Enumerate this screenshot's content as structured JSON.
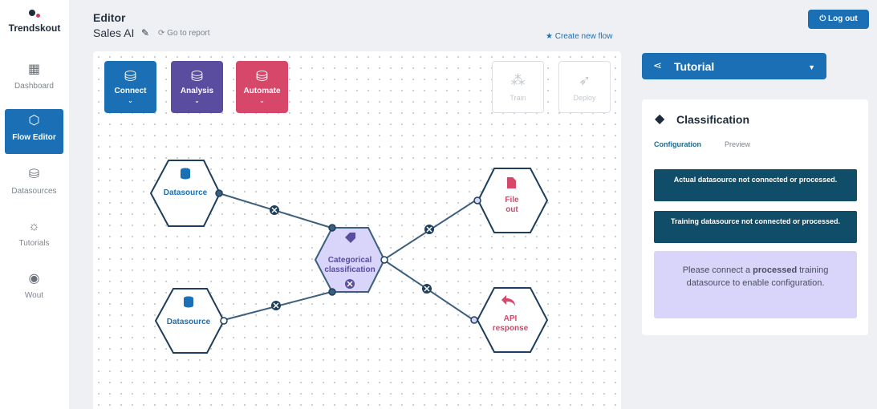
{
  "brand": {
    "name": "Trendskout"
  },
  "sidebar": {
    "items": [
      {
        "label": "Dashboard",
        "icon": "dashboard-grid-icon"
      },
      {
        "label": "Flow Editor",
        "icon": "flow-hexagon-icon",
        "active": true
      },
      {
        "label": "Datasources",
        "icon": "database-icon"
      },
      {
        "label": "Tutorials",
        "icon": "lightbulb-icon"
      },
      {
        "label": "Wout",
        "icon": "user-avatar-icon"
      }
    ]
  },
  "header": {
    "section": "Editor",
    "flow_name": "Sales AI",
    "goto_report": "Go to report",
    "create_new_flow": "Create new flow",
    "logout": "Log out"
  },
  "toolbar": {
    "connect": "Connect",
    "analysis": "Analysis",
    "automate": "Automate",
    "train": "Train",
    "deploy": "Deploy"
  },
  "flow": {
    "nodes": {
      "datasource_top": "Datasource",
      "datasource_bottom": "Datasource",
      "classification_line1": "Categorical",
      "classification_line2": "classification",
      "file_out_line1": "File",
      "file_out_line2": "out",
      "api_line1": "API",
      "api_line2": "response"
    }
  },
  "tutorial": {
    "label": "Tutorial"
  },
  "panel": {
    "title": "Classification",
    "tabs": {
      "configuration": "Configuration",
      "preview": "Preview"
    },
    "warning_actual": "Actual datasource not connected or processed.",
    "warning_training": "Training datasource not connected or processed.",
    "info_prefix": "Please connect a ",
    "info_bold": "processed",
    "info_suffix": " training datasource to enable configuration."
  },
  "colors": {
    "primary": "#1a6fb5",
    "analysis": "#5a4c9e",
    "automate": "#d6476a",
    "warning": "#0f4d68",
    "info_bg": "#d8d4fa"
  }
}
